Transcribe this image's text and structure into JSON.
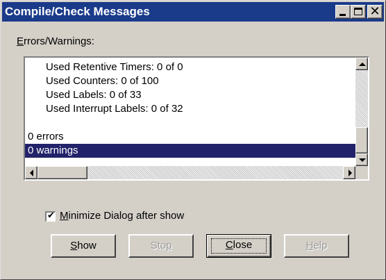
{
  "window": {
    "title": "Compile/Check Messages",
    "minimize_glyph": "_",
    "maximize_glyph": "□",
    "close_glyph": "✕"
  },
  "messages": {
    "label_accel": "E",
    "label_rest": "rrors/Warnings:",
    "lines": [
      "Used Retentive Timers: 0 of 0",
      "Used Counters: 0 of 100",
      "Used Labels: 0 of 33",
      "Used Interrupt Labels: 0 of 32",
      "",
      "0 errors",
      "0 warnings"
    ],
    "selected_index": 6
  },
  "options": {
    "minimize_accel": "M",
    "minimize_rest": "inimize  Dialog after show",
    "minimize_checked": true
  },
  "buttons": {
    "show": {
      "accel": "S",
      "rest": "how"
    },
    "stop": {
      "before": "Sto",
      "accel": "p",
      "rest": ""
    },
    "close": {
      "accel": "C",
      "rest": "lose"
    },
    "help": {
      "accel": "H",
      "rest": "elp"
    }
  },
  "colors": {
    "titlebar": "#1a3a8a",
    "selection": "#22226a",
    "face": "#d4d0c8"
  }
}
